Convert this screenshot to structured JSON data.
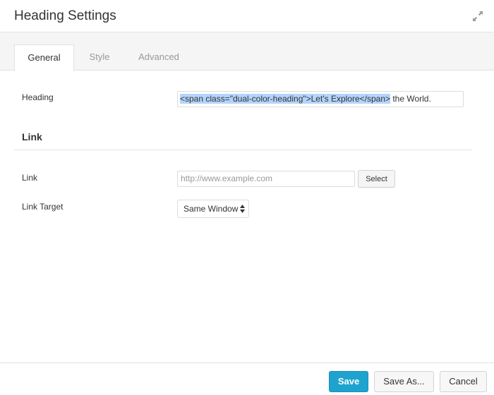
{
  "header": {
    "title": "Heading Settings",
    "expand_icon": "expand-arrows-icon"
  },
  "tabs": [
    {
      "label": "General",
      "active": true
    },
    {
      "label": "Style",
      "active": false
    },
    {
      "label": "Advanced",
      "active": false
    }
  ],
  "general": {
    "heading": {
      "label": "Heading",
      "value_selected": "<span class=\"dual-color-heading\">Let's Explore</span>",
      "value_rest": " the World."
    },
    "link_section": {
      "title": "Link",
      "link": {
        "label": "Link",
        "placeholder": "http://www.example.com",
        "value": "",
        "select_button": "Select"
      },
      "link_target": {
        "label": "Link Target",
        "selected": "Same Window"
      }
    }
  },
  "footer": {
    "save": "Save",
    "save_as": "Save As...",
    "cancel": "Cancel"
  },
  "colors": {
    "primary": "#1ea3cf",
    "selection": "#b3d4fc"
  }
}
